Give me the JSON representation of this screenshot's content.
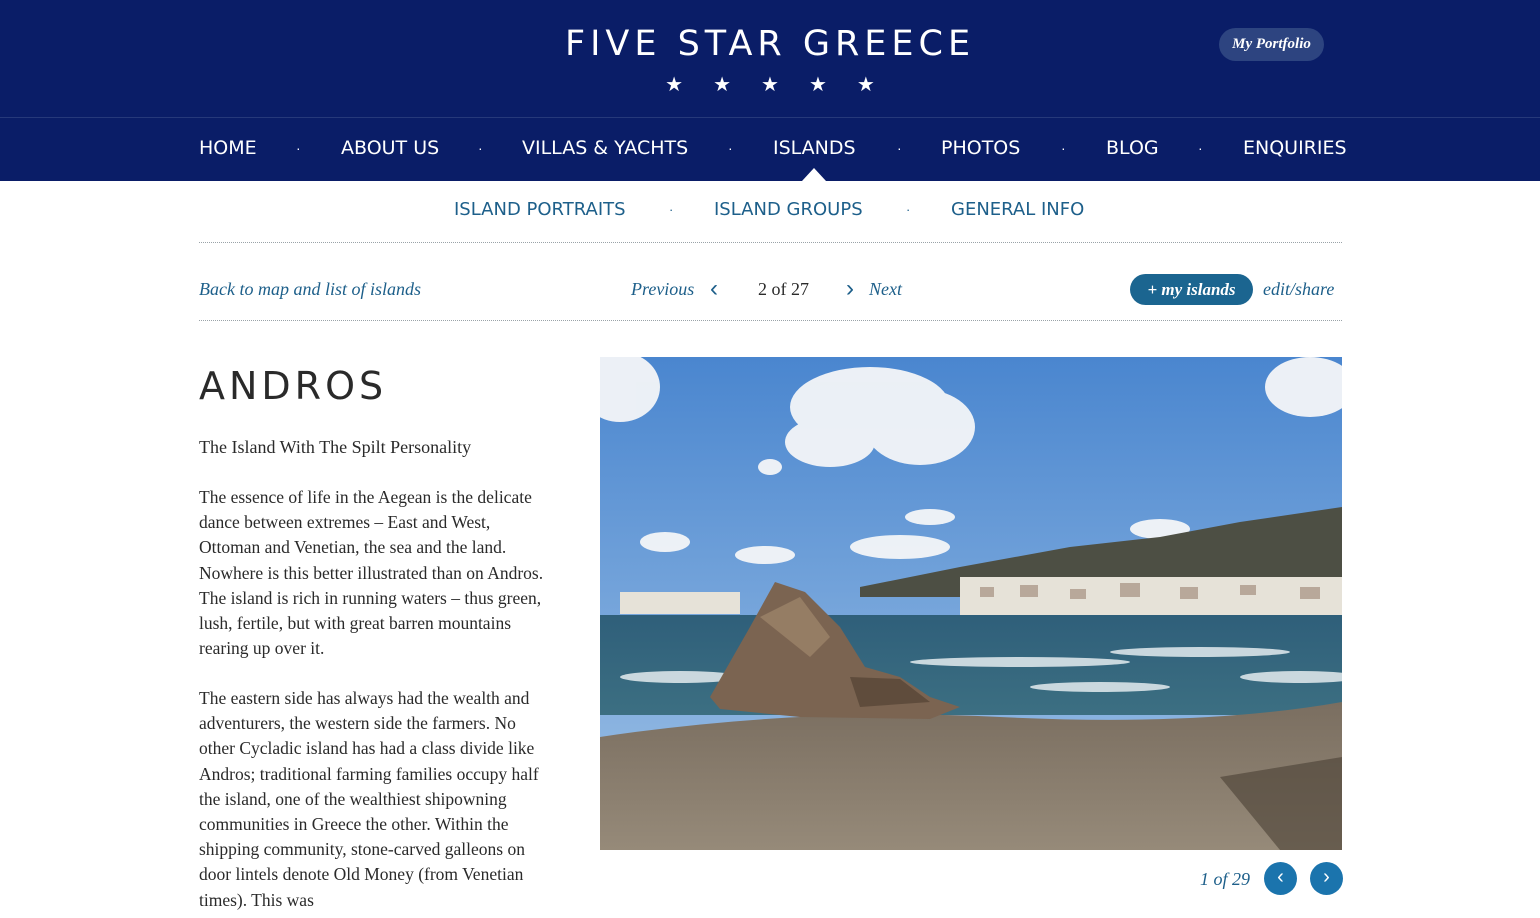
{
  "header": {
    "brand": "FIVE STAR GREECE",
    "stars": "★★★★★",
    "portfolio_label": "My Portfolio"
  },
  "nav": {
    "items": [
      "HOME",
      "ABOUT US",
      "VILLAS & YACHTS",
      "ISLANDS",
      "PHOTOS",
      "BLOG",
      "ENQUIRIES"
    ],
    "separator": "·",
    "active": "ISLANDS"
  },
  "subnav": {
    "items": [
      "ISLAND PORTRAITS",
      "ISLAND GROUPS",
      "GENERAL INFO"
    ],
    "separator": "·"
  },
  "pager": {
    "back_label": "Back to map and list of islands",
    "previous_label": "Previous",
    "counter": "2 of 27",
    "next_label": "Next",
    "my_islands_label": "+ my islands",
    "edit_share_label": "edit/share"
  },
  "content": {
    "title": "ANDROS",
    "tagline": "The Island With The Spilt Personality",
    "paragraphs": [
      "The essence of life in the Aegean is the delicate dance between extremes – East and West, Ottoman and Venetian, the sea and the land. Nowhere is this better illustrated than on Andros. The island is rich in running waters – thus green, lush, fertile, but with great barren mountains rearing up over it.",
      "The eastern side has always had the wealth and adventurers, the western side the farmers. No other Cycladic island has had a class divide like Andros; traditional farming families occupy half the island, one of the wealthiest shipowning communities in Greece the other. Within the shipping community, stone-carved galleons on door lintels denote Old Money (from Venetian times). This was"
    ]
  },
  "gallery": {
    "counter": "1 of 29",
    "prev_icon": "chevron-left-icon",
    "next_icon": "chevron-right-icon"
  },
  "colors": {
    "navy": "#0a1d67",
    "link_blue": "#1d5f8a",
    "button_blue": "#1b6590"
  }
}
